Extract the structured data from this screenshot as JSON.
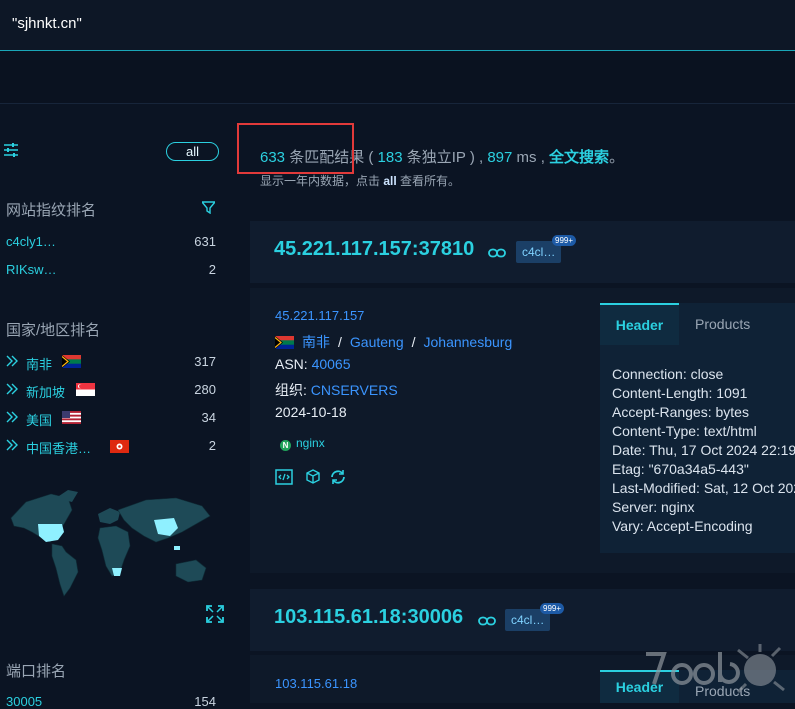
{
  "search": {
    "query": "\"sjhnkt.cn\""
  },
  "sidebar": {
    "all_label": "all",
    "fingerprint_title": "网站指纹排名",
    "fingerprints": [
      {
        "name": "c4cly1…",
        "count": "631"
      },
      {
        "name": "RIKsw…",
        "count": "2"
      }
    ],
    "country_title": "国家/地区排名",
    "countries": [
      {
        "name": "南非",
        "count": "317",
        "flag": "za-flag-icon"
      },
      {
        "name": "新加坡",
        "count": "280",
        "flag": "sg-flag-icon"
      },
      {
        "name": "美国",
        "count": "34",
        "flag": "us-flag-icon"
      },
      {
        "name": "中国香港…",
        "count": "2",
        "flag": "hk-flag-icon"
      }
    ],
    "port_title": "端口排名",
    "ports": [
      {
        "name": "30005",
        "count": "154"
      }
    ]
  },
  "summary": {
    "count": "633",
    "text1": "条匹配结果 (",
    "ip_count": "183",
    "text2": "条独立IP ) ,",
    "ms": "897",
    "text3": "ms ,",
    "fulltext_link": "全文搜索",
    "text4": "。",
    "hint_pre": "显示一年内数据，点击",
    "hint_all": "all",
    "hint_post": "查看所有。"
  },
  "results": [
    {
      "title": "45.221.117.157:37810",
      "tag": "c4cl…",
      "tag_sup": "999+",
      "ip": "45.221.117.157",
      "country": "南非",
      "region": "Gauteng",
      "city": "Johannesburg",
      "asn_label": "ASN:",
      "asn": "40065",
      "org_label": "组织:",
      "org": "CNSERVERS",
      "date": "2024-10-18",
      "product": "nginx",
      "tab_header": "Header",
      "tab_products": "Products",
      "headers": [
        "Connection: close",
        "Content-Length: 1091",
        "Accept-Ranges: bytes",
        "Content-Type: text/html",
        "Date: Thu, 17 Oct 2024 22:19",
        "Etag: \"670a34a5-443\"",
        "Last-Modified: Sat, 12 Oct 202",
        "Server: nginx",
        "Vary: Accept-Encoding"
      ]
    },
    {
      "title": "103.115.61.18:30006",
      "tag": "c4cl…",
      "tag_sup": "999+",
      "ip": "103.115.61.18",
      "tab_header": "Header",
      "tab_products": "Products"
    }
  ],
  "colors": {
    "accent": "#2bd0e0",
    "link": "#3b95ff",
    "highlight_box": "#e23a3a",
    "background": "#0b1423"
  }
}
